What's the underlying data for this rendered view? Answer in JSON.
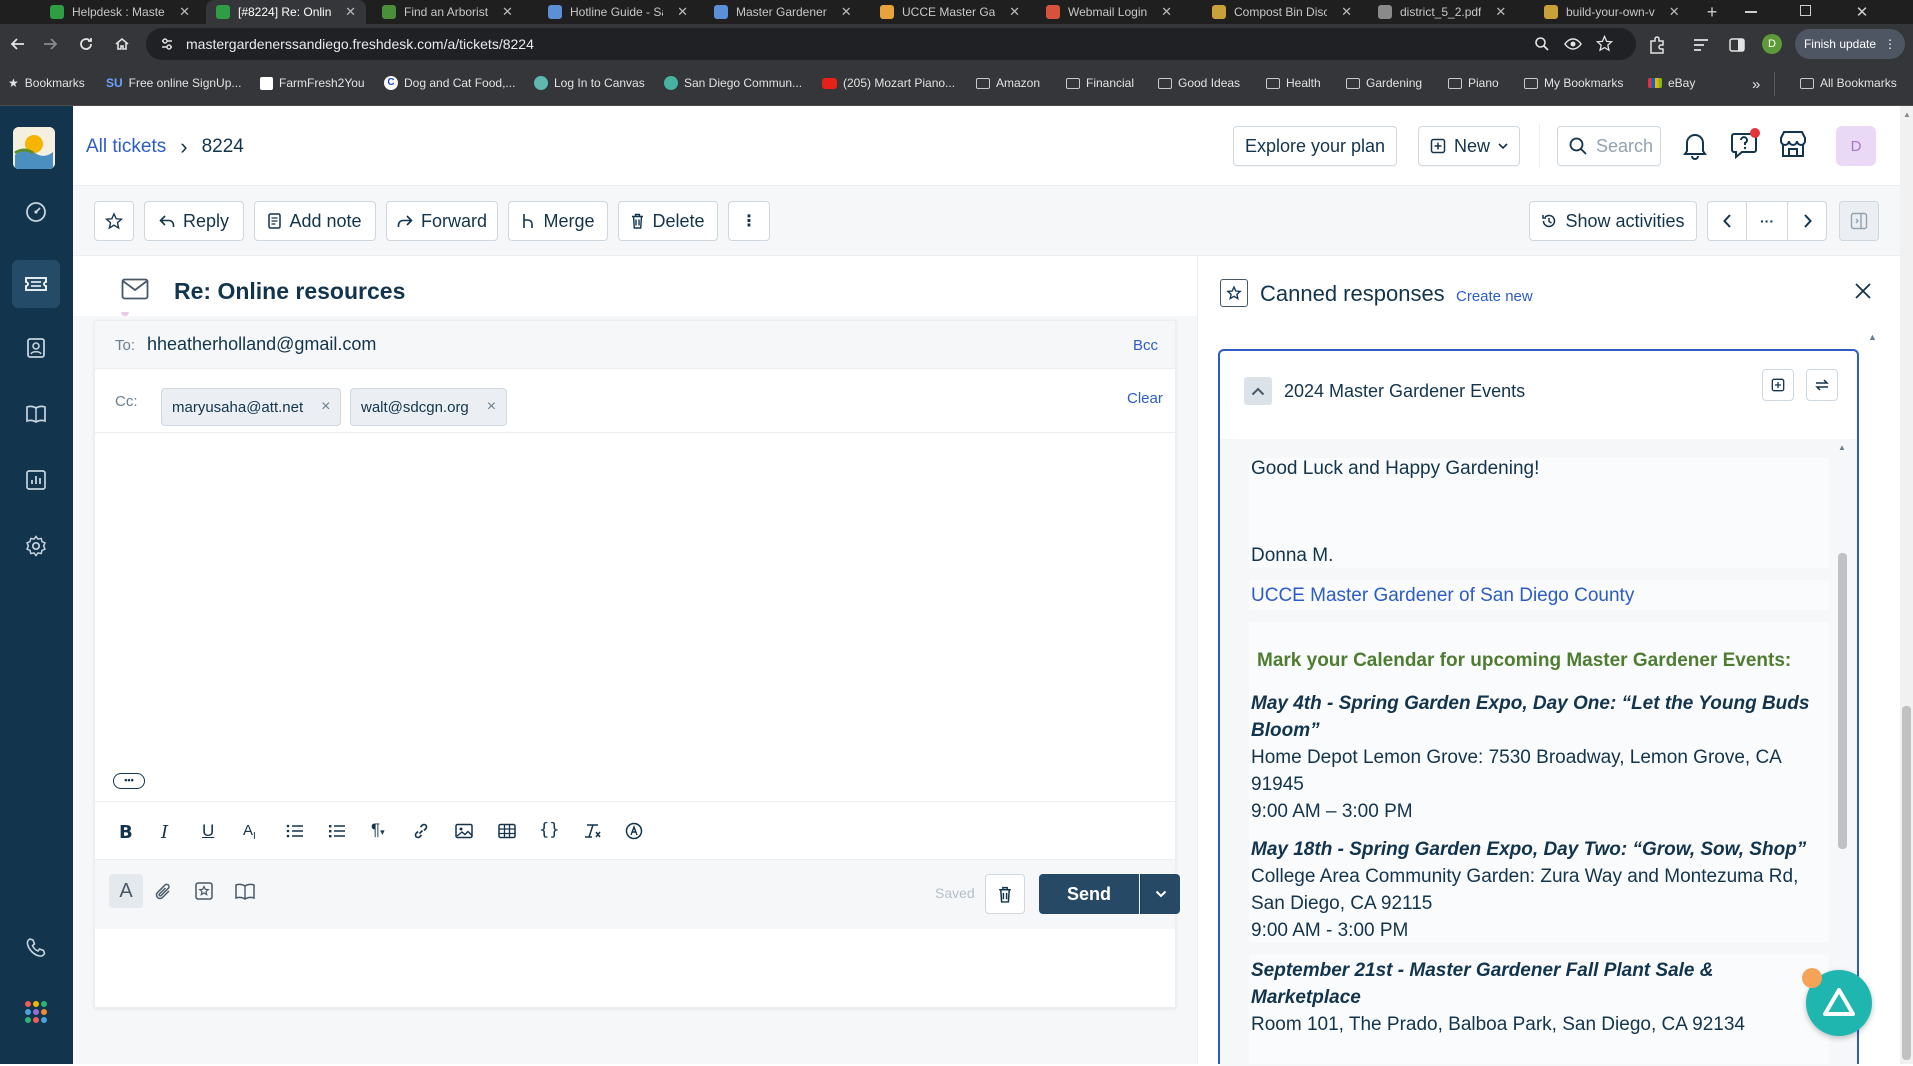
{
  "browser": {
    "tabs": [
      {
        "title": "Helpdesk : Master",
        "color": "#2e9e44"
      },
      {
        "title": "[#8224] Re: Online",
        "color": "#2e9e44"
      },
      {
        "title": "Find an Arborist",
        "color": "#4a8f3a"
      },
      {
        "title": "Hotline Guide - Sa",
        "color": "#5b8fd6"
      },
      {
        "title": "Master Gardener",
        "color": "#5b8fd6"
      },
      {
        "title": "UCCE Master Gar",
        "color": "#e8a33d"
      },
      {
        "title": "Webmail Login",
        "color": "#d6523a"
      },
      {
        "title": "Compost Bin Disc",
        "color": "#c9a13a"
      },
      {
        "title": "district_5_2.pdf",
        "color": "#8a8a8a"
      },
      {
        "title": "build-your-own-v",
        "color": "#c9a13a"
      }
    ],
    "url": "mastergardenerssandiego.freshdesk.com/a/tickets/8224",
    "finish_update": "Finish update",
    "profile_initial": "D",
    "bookmarks": [
      {
        "label": "Bookmarks",
        "icon": "star-icon"
      },
      {
        "label": "Free online SignUp...",
        "icon": "su-icon"
      },
      {
        "label": "FarmFresh2You",
        "icon": "farmfresh-icon"
      },
      {
        "label": "Dog and Cat Food,...",
        "icon": "chewy-icon"
      },
      {
        "label": "Log In to Canvas",
        "icon": "canvas-icon"
      },
      {
        "label": "San Diego Commun...",
        "icon": "sdcc-icon"
      },
      {
        "label": "(205) Mozart Piano...",
        "icon": "youtube-icon"
      },
      {
        "label": "Amazon",
        "icon": "folder-icon"
      },
      {
        "label": "Financial",
        "icon": "folder-icon"
      },
      {
        "label": "Good Ideas",
        "icon": "folder-icon"
      },
      {
        "label": "Health",
        "icon": "folder-icon"
      },
      {
        "label": "Gardening",
        "icon": "folder-icon"
      },
      {
        "label": "Piano",
        "icon": "folder-icon"
      },
      {
        "label": "My Bookmarks",
        "icon": "folder-icon"
      },
      {
        "label": "eBay",
        "icon": "ebay-icon"
      }
    ],
    "more_bookmarks": "»",
    "all_bookmarks": "All Bookmarks"
  },
  "header": {
    "breadcrumb_root": "All tickets",
    "breadcrumb_sep": "›",
    "ticket_id": "8224",
    "explore_plan": "Explore your plan",
    "new_label": "New",
    "search_placeholder": "Search",
    "avatar_initial": "D"
  },
  "toolbar": {
    "reply": "Reply",
    "add_note": "Add note",
    "forward": "Forward",
    "merge": "Merge",
    "delete": "Delete",
    "more": "⋮",
    "show_activities": "Show activities",
    "pager_more": "···"
  },
  "ticket": {
    "subject": "Re: Online resources"
  },
  "composer": {
    "to_label": "To:",
    "to_value": "hheatherholland@gmail.com",
    "bcc": "Bcc",
    "cc_label": "Cc:",
    "cc_chips": [
      "maryusaha@att.net",
      "walt@sdcgn.org"
    ],
    "chip_remove": "×",
    "clear": "Clear",
    "ellipsis": "•••",
    "saved": "Saved",
    "send": "Send"
  },
  "canned": {
    "title": "Canned responses",
    "create_new": "Create new",
    "folder_title": "2024 Master Gardener Events",
    "content": {
      "closing": "Good Luck and Happy Gardening!",
      "signature": "Donna M.",
      "org_link": "UCCE Master Gardener of San Diego County",
      "calendar_heading": "Mark your Calendar for upcoming Master Gardener Events:",
      "events": [
        {
          "title_line1": "May 4th - Spring Garden Expo, Day One: “Let the Young Buds",
          "title_line2": "Bloom”",
          "address_line1": " Home Depot Lemon Grove: 7530 Broadway, Lemon Grove, CA",
          "address_line2": "91945",
          "time": " 9:00 AM – 3:00 PM"
        },
        {
          "title_line1": "May 18th - Spring Garden Expo, Day Two: “Grow, Sow, Shop”",
          "title_line2": "",
          "address_line1": " College Area Community Garden: Zura Way and Montezuma Rd,",
          "address_line2": "San Diego, CA 92115",
          "time": " 9:00 AM - 3:00 PM"
        },
        {
          "title_line1": "September 21st - Master Gardener Fall Plant Sale &",
          "title_line2": "Marketplace",
          "address_line1": " Room 101, The Prado, Balboa Park, San Diego, CA 92134",
          "address_line2": "",
          "time": ""
        }
      ]
    }
  },
  "colors": {
    "nav_bg": "#12344d",
    "accent": "#2c5cc5",
    "send_bg": "#264966",
    "heading_green": "#4e7d32",
    "fab": "#1fb6b0"
  }
}
